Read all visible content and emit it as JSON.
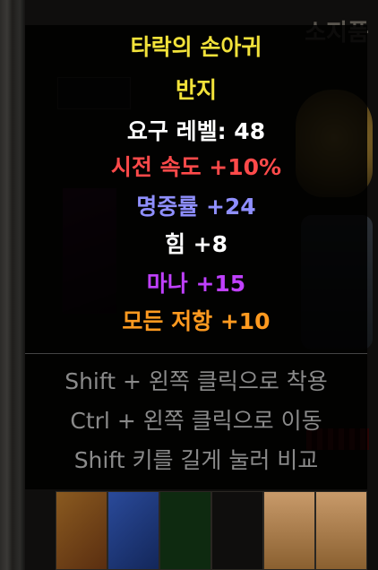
{
  "background": {
    "tab_label": "소지품"
  },
  "tooltip": {
    "item_name": {
      "text": "타락의 손아귀",
      "color": "#f2e23a"
    },
    "item_type": {
      "text": "반지",
      "color": "#f2e23a"
    },
    "properties": [
      {
        "text": "요구 레벨: 48",
        "color": "#ffffff"
      },
      {
        "text": "시전 속도 +10%",
        "color": "#ff4a4a"
      },
      {
        "text": "명중률 +24",
        "color": "#8f8fff"
      },
      {
        "text": "힘 +8",
        "color": "#ffffff"
      },
      {
        "text": "마나 +15",
        "color": "#c040ff"
      },
      {
        "text": "모든 저항 +10",
        "color": "#ff9a20"
      }
    ],
    "hints": [
      "Shift + 왼쪽 클릭으로 착용",
      "Ctrl + 왼쪽 클릭으로 이동",
      "Shift 키를 길게 눌러 비교"
    ]
  }
}
